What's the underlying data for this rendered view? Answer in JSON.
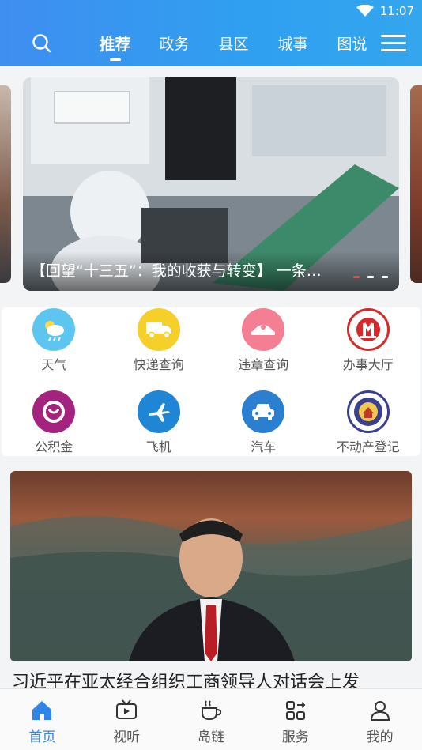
{
  "status": {
    "time": "11:07"
  },
  "header": {
    "tabs": [
      {
        "label": "推荐",
        "active": true
      },
      {
        "label": "政务"
      },
      {
        "label": "县区"
      },
      {
        "label": "城事"
      },
      {
        "label": "图说"
      }
    ]
  },
  "carousel": {
    "caption": "【回望“十三五”：我的收获与转变】 一条…",
    "slide_count": 3,
    "active_index": 0
  },
  "services": [
    {
      "label": "天气",
      "icon": "weather-icon",
      "color": "#5cc6f0"
    },
    {
      "label": "快递查询",
      "icon": "delivery-truck-icon",
      "color": "#f5cf2a"
    },
    {
      "label": "违章查询",
      "icon": "traffic-police-icon",
      "color": "#f47f93"
    },
    {
      "label": "办事大厅",
      "icon": "service-hall-icon",
      "color": "#d7282a"
    },
    {
      "label": "公积金",
      "icon": "housing-fund-icon",
      "color": "#a4237f"
    },
    {
      "label": "飞机",
      "icon": "airplane-icon",
      "color": "#1e86d5"
    },
    {
      "label": "汽车",
      "icon": "car-icon",
      "color": "#2a7fd0"
    },
    {
      "label": "不动产登记",
      "icon": "real-estate-seal-icon",
      "color": "#3a3f8f"
    }
  ],
  "news": {
    "headline": "习近平在亚太经合组织工商领导人对话会上发"
  },
  "bottom_nav": [
    {
      "label": "首页",
      "icon": "home-icon",
      "active": true
    },
    {
      "label": "视听",
      "icon": "tv-icon"
    },
    {
      "label": "岛链",
      "icon": "coffee-cup-icon"
    },
    {
      "label": "服务",
      "icon": "services-grid-icon"
    },
    {
      "label": "我的",
      "icon": "user-icon"
    }
  ],
  "colors": {
    "accent": "#2f86e8",
    "header": "#3a96f0"
  }
}
